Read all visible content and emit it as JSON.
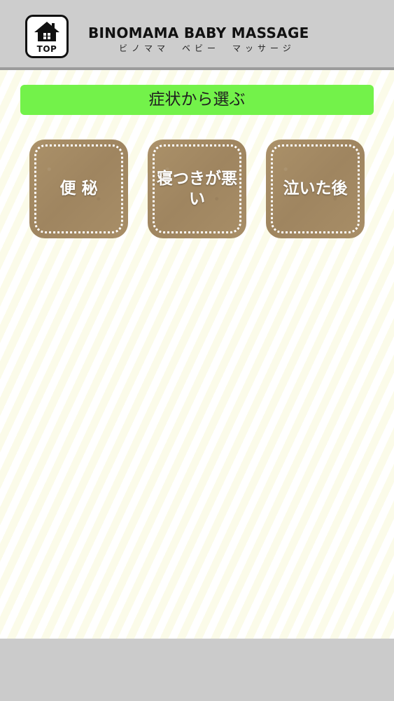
{
  "header": {
    "home_button": {
      "label": "TOP",
      "icon": "house-icon"
    },
    "title": "BINOMAMA BABY MASSAGE",
    "subtitle": "ビノママ　ベビー　マッサージ"
  },
  "section": {
    "title": "症状から選ぶ"
  },
  "symptoms": [
    {
      "label": "便秘"
    },
    {
      "label": "寝つきが悪い"
    },
    {
      "label": "泣いた後"
    }
  ],
  "colors": {
    "header_bg": "#cdcdcd",
    "section_bar": "#73f24a",
    "tile_bg": "#a48a64",
    "stripe": "#fbfbe9",
    "footer_bg": "#cbcbcb"
  }
}
